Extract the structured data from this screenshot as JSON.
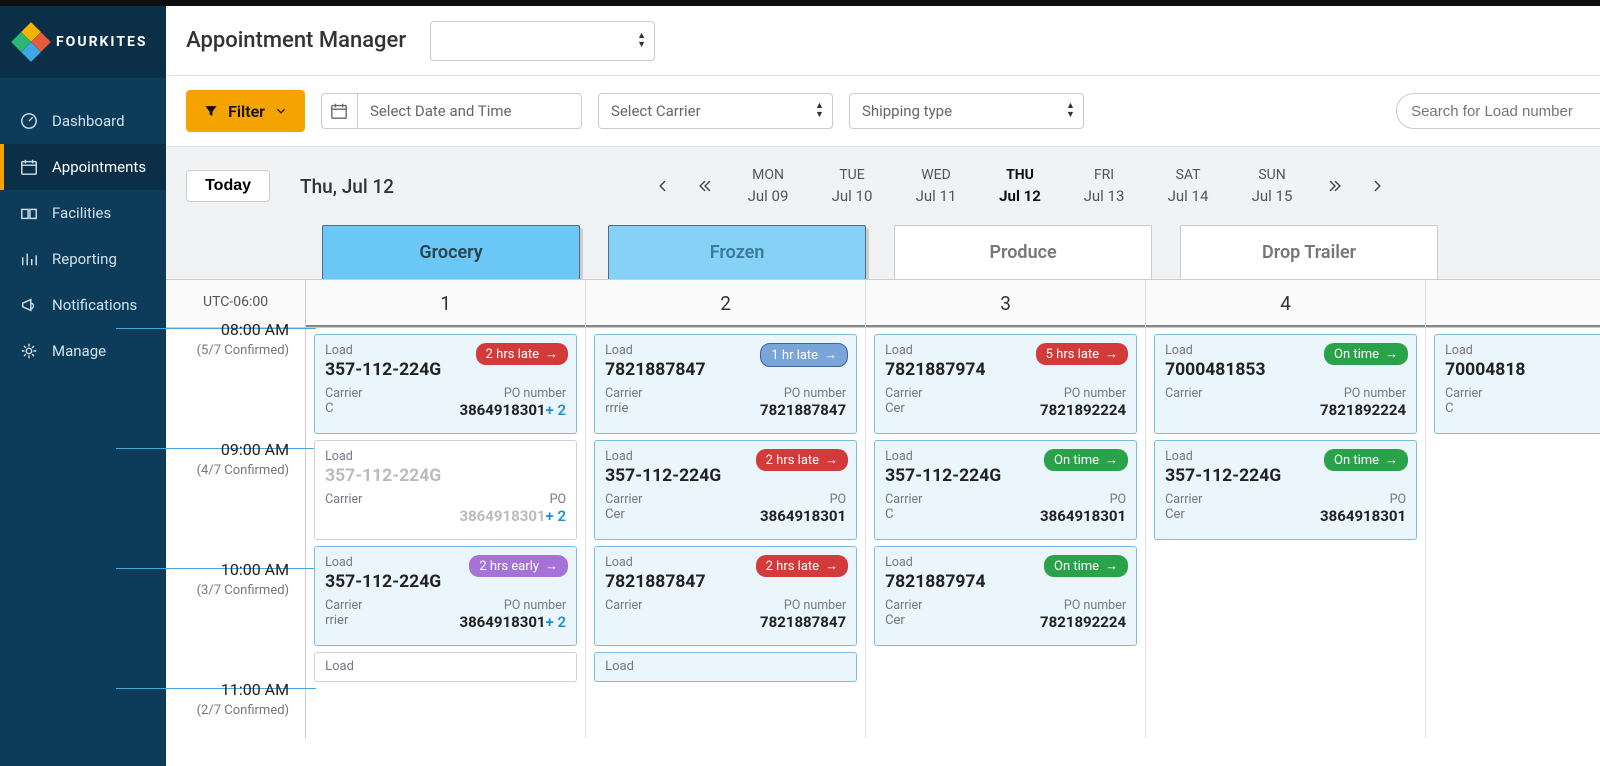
{
  "brand": "FOURKITES",
  "nav": {
    "dashboard": "Dashboard",
    "appointments": "Appointments",
    "facilities": "Facilities",
    "reporting": "Reporting",
    "notifications": "Notifications",
    "manage": "Manage"
  },
  "header": {
    "title": "Appointment Manager",
    "facilitySelect": ""
  },
  "toolbar": {
    "filter": "Filter",
    "datePlaceholder": "Select Date and Time",
    "carrierPlaceholder": "Select Carrier",
    "shippingPlaceholder": "Shipping type",
    "searchPlaceholder": "Search for Load number"
  },
  "datenav": {
    "today": "Today",
    "current": "Thu, Jul 12",
    "days": [
      {
        "dow": "MON",
        "md": "Jul 09"
      },
      {
        "dow": "TUE",
        "md": "Jul 10"
      },
      {
        "dow": "WED",
        "md": "Jul 11"
      },
      {
        "dow": "THU",
        "md": "Jul 12"
      },
      {
        "dow": "FRI",
        "md": "Jul 13"
      },
      {
        "dow": "SAT",
        "md": "Jul 14"
      },
      {
        "dow": "SUN",
        "md": "Jul 15"
      }
    ]
  },
  "docks": {
    "grocery": "Grocery",
    "frozen": "Frozen",
    "produce": "Produce",
    "drop": "Drop Trailer"
  },
  "sched": {
    "tz": "UTC-06:00",
    "cols": [
      "1",
      "2",
      "3",
      "4"
    ],
    "slots": [
      {
        "time": "08:00 AM",
        "confirmed": "(5/7 Confirmed)"
      },
      {
        "time": "09:00 AM",
        "confirmed": "(4/7 Confirmed)"
      },
      {
        "time": "10:00 AM",
        "confirmed": "(3/7 Confirmed)"
      },
      {
        "time": "11:00 AM",
        "confirmed": "(2/7 Confirmed)"
      }
    ]
  },
  "labels": {
    "load": "Load",
    "carrier": "Carrier",
    "po": "PO number",
    "poShort": "PO"
  },
  "cards": {
    "r0c0": {
      "load": "357-112-224G",
      "carrier": "C",
      "po": "3864918301",
      "extra": "+ 2",
      "badge": "2 hrs late",
      "badgeType": "red"
    },
    "r0c1": {
      "load": "7821887847",
      "carrier": "rrrie",
      "po": "7821887847",
      "badge": "1 hr late",
      "badgeType": "blue"
    },
    "r0c2": {
      "load": "7821887974",
      "carrier": "Cer",
      "po": "7821892224",
      "badge": "5 hrs late",
      "badgeType": "red"
    },
    "r0c3": {
      "load": "7000481853",
      "carrier": "",
      "po": "7821892224",
      "badge": "On time",
      "badgeType": "green"
    },
    "r0c4": {
      "load": "70004818",
      "carrier": "C"
    },
    "r1c0": {
      "load": "357-112-224G",
      "carrier": "",
      "po": "3864918301",
      "extra": "+ 2",
      "plain": true
    },
    "r1c1": {
      "load": "357-112-224G",
      "carrier": "Cer",
      "po": "3864918301",
      "badge": "2 hrs late",
      "badgeType": "red"
    },
    "r1c2": {
      "load": "357-112-224G",
      "carrier": "C",
      "po": "3864918301",
      "badge": "On time",
      "badgeType": "green"
    },
    "r1c3": {
      "load": "357-112-224G",
      "carrier": "Cer",
      "po": "3864918301",
      "badge": "On time",
      "badgeType": "green"
    },
    "r2c0": {
      "load": "357-112-224G",
      "carrier": "rrier",
      "po": "3864918301",
      "extra": "+ 2",
      "badge": "2 hrs early",
      "badgeType": "purple"
    },
    "r2c1": {
      "load": "7821887847",
      "carrier": "",
      "po": "7821887847",
      "badge": "2 hrs late",
      "badgeType": "red"
    },
    "r2c2": {
      "load": "7821887974",
      "carrier": "Cer",
      "po": "7821892224",
      "badge": "On time",
      "badgeType": "green"
    }
  }
}
